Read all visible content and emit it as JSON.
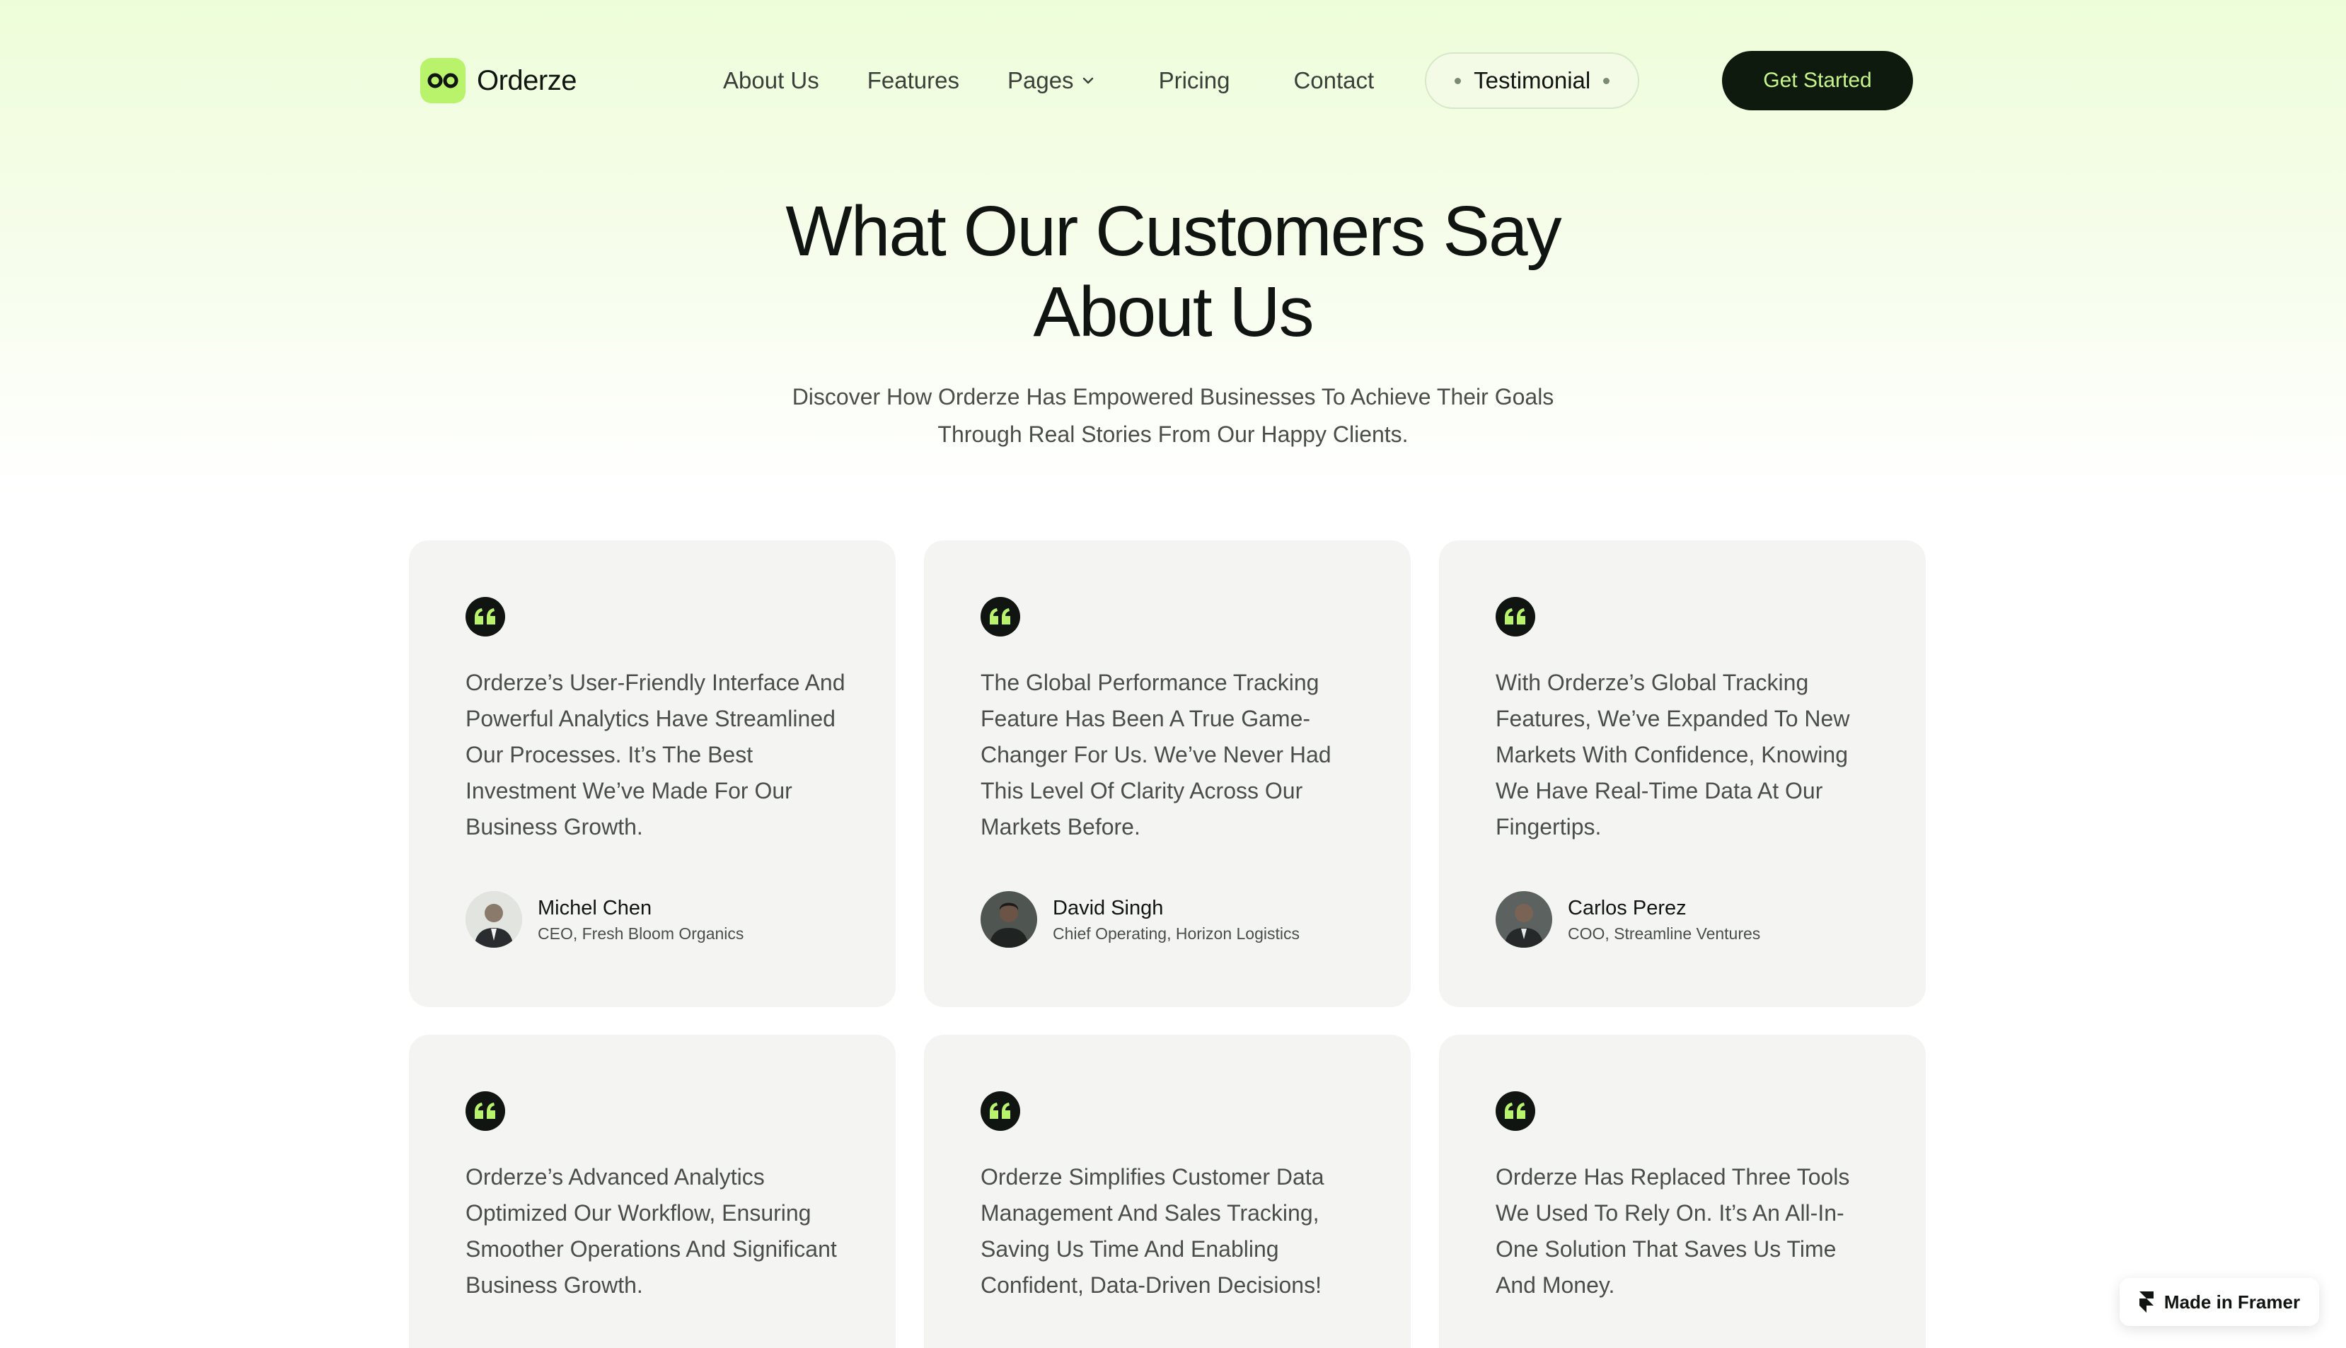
{
  "brand": {
    "name": "Orderze",
    "accent": "#b8f36b",
    "dark": "#0f1a0e",
    "cta_text_color": "#c8f58a"
  },
  "nav": {
    "links": [
      "About Us",
      "Features",
      "Pages",
      "Pricing",
      "Contact"
    ],
    "active": "Testimonial",
    "cta": "Get Started"
  },
  "hero": {
    "title_line1": "What Our Customers Say",
    "title_line2": "About Us",
    "subtitle_line1": "Discover How Orderze Has Empowered Businesses To Achieve Their Goals",
    "subtitle_line2": "Through Real Stories From Our Happy Clients."
  },
  "testimonials": [
    {
      "text": "Orderze’s User-Friendly Interface And Powerful Analytics Have Streamlined Our Processes. It’s The Best Investment We’ve Made For Our Business Growth.",
      "name": "Michel Chen",
      "role": "CEO, Fresh Bloom Organics"
    },
    {
      "text": "The Global Performance Tracking Feature Has Been A True Game-Changer For Us. We’ve Never Had This Level Of Clarity Across Our Markets Before.",
      "name": "David Singh",
      "role": "Chief Operating, Horizon Logistics"
    },
    {
      "text": "With Orderze’s Global Tracking Features, We’ve Expanded To New Markets With Confidence, Knowing We Have Real-Time Data At Our Fingertips.",
      "name": "Carlos Perez",
      "role": "COO, Streamline Ventures"
    },
    {
      "text": "Orderze’s Advanced Analytics Optimized Our Workflow, Ensuring Smoother Operations And Significant Business Growth."
    },
    {
      "text": "Orderze Simplifies Customer Data Management And Sales Tracking, Saving Us Time And Enabling Confident, Data-Driven Decisions!"
    },
    {
      "text": "Orderze Has Replaced Three Tools We Used To Rely On. It’s An All-In-One Solution That Saves Us Time And Money."
    }
  ],
  "framer_badge": "Made in Framer"
}
